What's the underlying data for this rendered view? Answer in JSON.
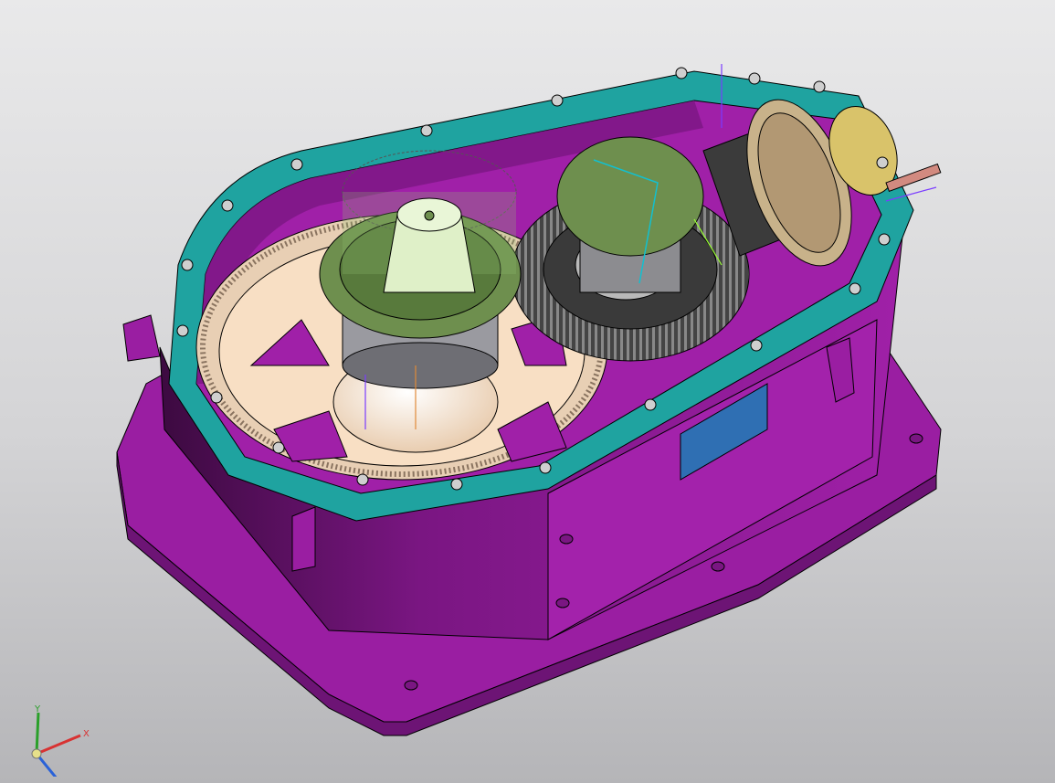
{
  "viewport": {
    "background_top": "#e9e9ea",
    "background_bottom": "#b5b5b8"
  },
  "model": {
    "housing_color": "#a020a8",
    "housing_dark": "#5a0f60",
    "housing_light": "#b33ab9",
    "flange_color": "#1fa3a0",
    "gear_wheel_color": "#f8dfc4",
    "bearing_cover_color": "#6e8f4e",
    "bevel_gear_color": "#5a5a5a",
    "spur_gear_color": "#c8b28a",
    "nameplate_color": "#2f6fb3",
    "coupling_color": "#d9c36a",
    "shaft_color": "#d28a80",
    "bolt_color": "#cfcfcf"
  },
  "triad": {
    "x_label": "X",
    "y_label": "Y",
    "x_color": "#d83232",
    "y_color": "#2aa02a",
    "z_color": "#2a62d8"
  }
}
